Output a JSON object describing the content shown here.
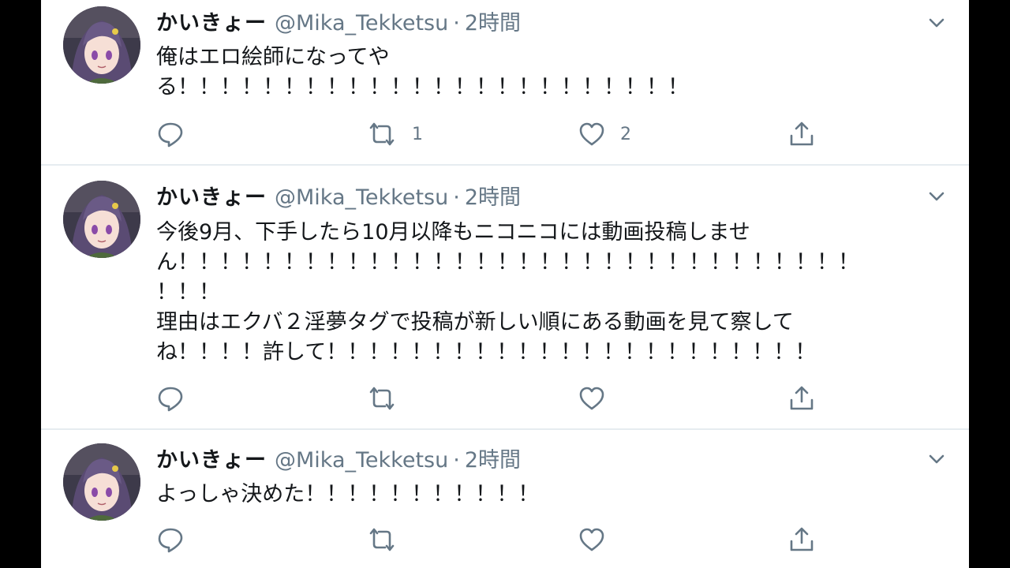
{
  "tweets": [
    {
      "name": "かいきょー",
      "handle": "@Mika_Tekketsu",
      "separator": "·",
      "time": "2時間",
      "lines": [
        "俺はエロ絵師になってや",
        "る！！！！！！！！！！！！！！！！！！！！！！！！"
      ],
      "retweets": "1",
      "likes": "2"
    },
    {
      "name": "かいきょー",
      "handle": "@Mika_Tekketsu",
      "separator": "·",
      "time": "2時間",
      "lines": [
        "今後9月、下手したら10月以降もニコニコには動画投稿しませ",
        "ん！！！！！！！！！！！！！！！！！！！！！！！！！！！！！！！！",
        "！！！",
        "理由はエクバ２淫夢タグで投稿が新しい順にある動画を見て察して",
        "ね！！！！許して！！！！！！！！！！！！！！！！！！！！！！！"
      ],
      "retweets": "",
      "likes": ""
    },
    {
      "name": "かいきょー",
      "handle": "@Mika_Tekketsu",
      "separator": "·",
      "time": "2時間",
      "lines": [
        "よっしゃ決めた！！！！！！！！！！！"
      ],
      "retweets": "",
      "likes": ""
    }
  ],
  "icons": {
    "reply": "reply-icon",
    "retweet": "retweet-icon",
    "like": "like-icon",
    "share": "share-icon",
    "caret": "chevron-down-icon"
  },
  "colors": {
    "text": "#14171a",
    "secondary": "#657786",
    "divider": "#e6ecf0",
    "background": "#ffffff"
  }
}
